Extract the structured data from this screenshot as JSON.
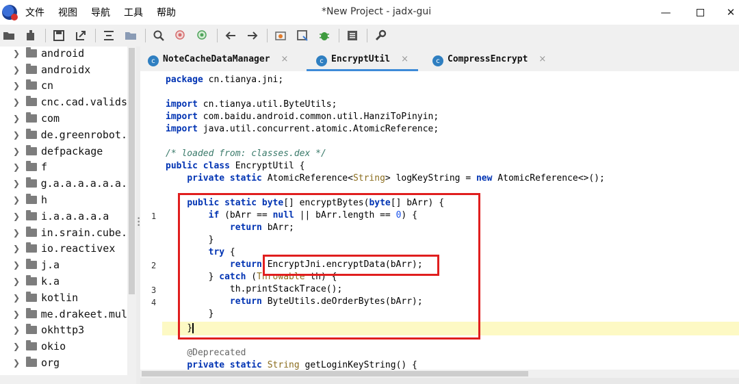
{
  "window": {
    "title": "*New Project - jadx-gui",
    "minimize": "—",
    "close": "✕"
  },
  "menu": [
    "文件",
    "视图",
    "导航",
    "工具",
    "帮助"
  ],
  "tree": {
    "items": [
      "android",
      "androidx",
      "cn",
      "cnc.cad.valids",
      "com",
      "de.greenrobot.",
      "defpackage",
      "f",
      "g.a.a.a.a.a.a.",
      "h",
      "i.a.a.a.a.a",
      "in.srain.cube.",
      "io.reactivex",
      "j.a",
      "k.a",
      "kotlin",
      "me.drakeet.mul",
      "okhttp3",
      "okio",
      "org"
    ]
  },
  "tabs": [
    {
      "label": "NoteCacheDataManager",
      "icon": "c"
    },
    {
      "label": "EncryptUtil",
      "icon": "c"
    },
    {
      "label": "CompressEncrypt",
      "icon": "c"
    }
  ],
  "tab_close": "×",
  "gutter": [
    "1",
    "2",
    "3",
    "4"
  ],
  "code": {
    "l1_kw": "package",
    "l1_rest": " cn.tianya.jni;",
    "l2_kw": "import",
    "l2_rest": " cn.tianya.util.ByteUtils;",
    "l3_kw": "import",
    "l3_rest": " com.baidu.android.common.util.HanziToPinyin;",
    "l4_kw": "import",
    "l4_rest": " java.util.concurrent.atomic.AtomicReference;",
    "l5_comment": "/* loaded from: classes.dex */",
    "l6_kw": "public class",
    "l6_rest": " EncryptUtil {",
    "l7_kw": "private static",
    "l7_a": " AtomicReference<",
    "l7_type": "String",
    "l7_b": "> logKeyString = ",
    "l7_kw2": "new",
    "l7_c": " AtomicReference<>();",
    "l8_kw": "public static byte",
    "l8_a": "[] encryptBytes(",
    "l8_kw2": "byte",
    "l8_b": "[] bArr) {",
    "l9_kw": "if",
    "l9_a": " (bArr == ",
    "l9_kw2": "null",
    "l9_b": " || bArr.length == ",
    "l9_num": "0",
    "l9_c": ") {",
    "l10_kw": "return",
    "l10_rest": " bArr;",
    "l11": "}",
    "l12_kw": "try",
    "l12_rest": " {",
    "l13_kw": "return",
    "l13_rest": " EncryptJni.encryptData(bArr);",
    "l14_a": "} ",
    "l14_kw": "catch",
    "l14_b": " (",
    "l14_type": "Throwable",
    "l14_c": " th) {",
    "l15": "th.printStackTrace();",
    "l16_kw": "return",
    "l16_rest": " ByteUtils.deOrderBytes(bArr);",
    "l17": "}",
    "l18": "}",
    "l19_ann": "@Deprecated",
    "l20_kw": "private static",
    "l20_a": " ",
    "l20_type": "String",
    "l20_b": " getLoginKeyString() {"
  }
}
